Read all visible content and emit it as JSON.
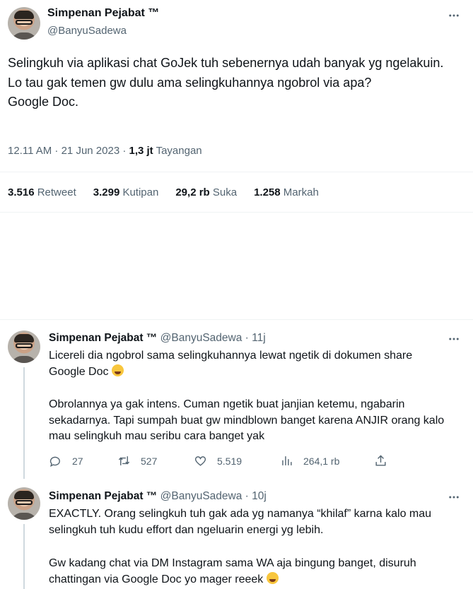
{
  "main_tweet": {
    "author_name": "Simpenan Pejabat ™",
    "handle": "@BanyuSadewa",
    "text": "Selingkuh via aplikasi chat GoJek tuh sebenernya udah banyak yg ngelakuin. Lo tau gak temen gw dulu ama selingkuhannya ngobrol via apa?\nGoogle Doc.",
    "time": "12.11 AM · 21 Jun 2023 · ",
    "views_count": "1,3 jt",
    "views_label": " Tayangan",
    "stats": [
      {
        "count": "3.516",
        "label": " Retweet"
      },
      {
        "count": "3.299",
        "label": " Kutipan"
      },
      {
        "count": "29,2 rb",
        "label": " Suka"
      },
      {
        "count": "1.258",
        "label": " Markah"
      }
    ]
  },
  "replies": [
    {
      "author_name": "Simpenan Pejabat ™",
      "meta": " @BanyuSadewa · 11j",
      "text_line1": "Licereli dia ngobrol sama selingkuhannya lewat ngetik di dokumen share\nGoogle Doc ",
      "text_rest": "Obrolannya ya gak intens. Cuman ngetik buat janjian ketemu, ngabarin sekadarnya. Tapi sumpah buat gw mindblown banget karena ANJIR orang kalo mau selingkuh mau seribu cara banget yak",
      "emoji_icon": "face-with-tears-of-joy",
      "actions": {
        "replies": "27",
        "retweets": "527",
        "likes": "5.519",
        "views": "264,1 rb"
      }
    },
    {
      "author_name": "Simpenan Pejabat ™",
      "meta": " @BanyuSadewa · 10j",
      "text_line1": "EXACTLY. Orang selingkuh tuh gak ada yg namanya “khilaf” karna kalo mau selingkuh tuh kudu effort dan ngeluarin energi yg lebih.",
      "text_rest": "Gw kadang chat via DM Instagram sama WA aja bingung banget, disuruh chattingan via Google Doc yo mager reeek ",
      "emoji_icon": "loudly-crying-face"
    }
  ],
  "colors": {
    "text": "#0f1419",
    "secondary": "#536471",
    "divider": "#eff3f4",
    "thread": "#cfd9de"
  }
}
